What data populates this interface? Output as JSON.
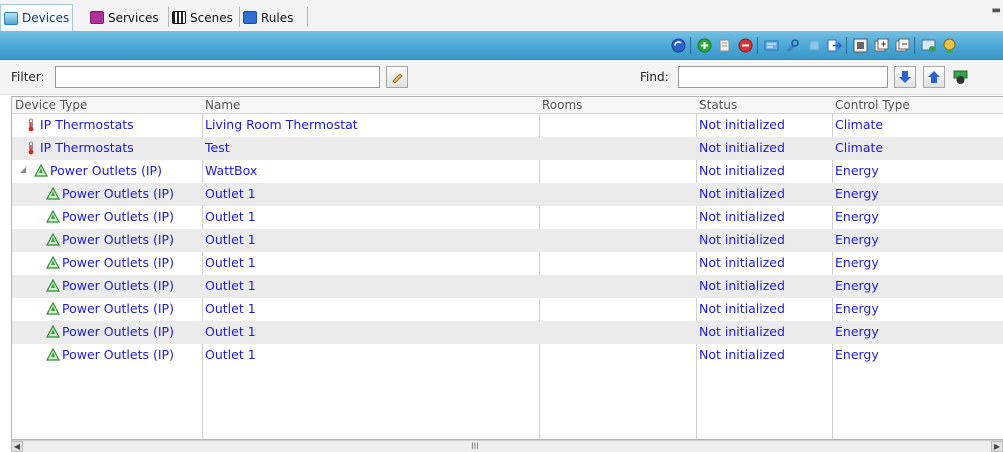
{
  "tabs": [
    {
      "label": "Devices",
      "icon": "devices-icon",
      "color": "#4aa7d6",
      "active": true
    },
    {
      "label": "Services",
      "icon": "services-icon",
      "color": "#b0309a",
      "active": false
    },
    {
      "label": "Scenes",
      "icon": "scenes-icon",
      "color": "#222222",
      "active": false
    },
    {
      "label": "Rules",
      "icon": "rules-icon",
      "color": "#2f6fd0",
      "active": false
    }
  ],
  "toolbar": {
    "buttons": [
      {
        "name": "refresh-icon",
        "color": "#2a63c9"
      },
      {
        "name": "add-icon",
        "color": "#2eaa3c"
      },
      {
        "name": "copy-icon",
        "color": "#e0e0e0"
      },
      {
        "name": "remove-icon",
        "color": "#d93333"
      },
      {
        "name": "edit-icon",
        "color": "#4c8fd8"
      },
      {
        "name": "configure-icon",
        "color": "#3d7ccc"
      },
      {
        "name": "disabled-icon",
        "color": "#5aa7d8"
      },
      {
        "name": "export-icon",
        "color": "#3a86d4"
      },
      {
        "name": "grid-view-icon",
        "color": "#666666"
      },
      {
        "name": "expand-icon",
        "color": "#777777"
      },
      {
        "name": "collapse-icon",
        "color": "#777777"
      },
      {
        "name": "properties-icon",
        "color": "#3aa04a"
      },
      {
        "name": "globe-icon",
        "color": "#3aa04a"
      }
    ]
  },
  "filter": {
    "label": "Filter:",
    "value": ""
  },
  "find": {
    "label": "Find:",
    "value": ""
  },
  "grid": {
    "headers": [
      "Device Type",
      "Name",
      "Rooms",
      "Status",
      "Control Type"
    ],
    "rows": [
      {
        "type": "IP Thermostats",
        "icon": "thermometer-icon",
        "name": "Living Room Thermostat",
        "rooms": "",
        "status": "Not initialized",
        "control": "Climate",
        "indent": 0,
        "expander": false
      },
      {
        "type": "IP Thermostats",
        "icon": "thermometer-icon",
        "name": "Test",
        "rooms": "",
        "status": "Not initialized",
        "control": "Climate",
        "indent": 0,
        "expander": false
      },
      {
        "type": "Power Outlets (IP)",
        "icon": "power-outlet-icon",
        "name": "WattBox",
        "rooms": "",
        "status": "Not initialized",
        "control": "Energy",
        "indent": 0,
        "expander": true
      },
      {
        "type": "Power Outlets (IP)",
        "icon": "power-outlet-icon",
        "name": "Outlet 1",
        "rooms": "",
        "status": "Not initialized",
        "control": "Energy",
        "indent": 1,
        "expander": false
      },
      {
        "type": "Power Outlets (IP)",
        "icon": "power-outlet-icon",
        "name": "Outlet 1",
        "rooms": "",
        "status": "Not initialized",
        "control": "Energy",
        "indent": 1,
        "expander": false
      },
      {
        "type": "Power Outlets (IP)",
        "icon": "power-outlet-icon",
        "name": "Outlet 1",
        "rooms": "",
        "status": "Not initialized",
        "control": "Energy",
        "indent": 1,
        "expander": false
      },
      {
        "type": "Power Outlets (IP)",
        "icon": "power-outlet-icon",
        "name": "Outlet 1",
        "rooms": "",
        "status": "Not initialized",
        "control": "Energy",
        "indent": 1,
        "expander": false
      },
      {
        "type": "Power Outlets (IP)",
        "icon": "power-outlet-icon",
        "name": "Outlet 1",
        "rooms": "",
        "status": "Not initialized",
        "control": "Energy",
        "indent": 1,
        "expander": false
      },
      {
        "type": "Power Outlets (IP)",
        "icon": "power-outlet-icon",
        "name": "Outlet 1",
        "rooms": "",
        "status": "Not initialized",
        "control": "Energy",
        "indent": 1,
        "expander": false
      },
      {
        "type": "Power Outlets (IP)",
        "icon": "power-outlet-icon",
        "name": "Outlet 1",
        "rooms": "",
        "status": "Not initialized",
        "control": "Energy",
        "indent": 1,
        "expander": false
      },
      {
        "type": "Power Outlets (IP)",
        "icon": "power-outlet-icon",
        "name": "Outlet 1",
        "rooms": "",
        "status": "Not initialized",
        "control": "Energy",
        "indent": 1,
        "expander": false
      }
    ]
  },
  "colors": {
    "link_text": "#1c1cd6",
    "toolbar_band": "#4aa7d6"
  }
}
